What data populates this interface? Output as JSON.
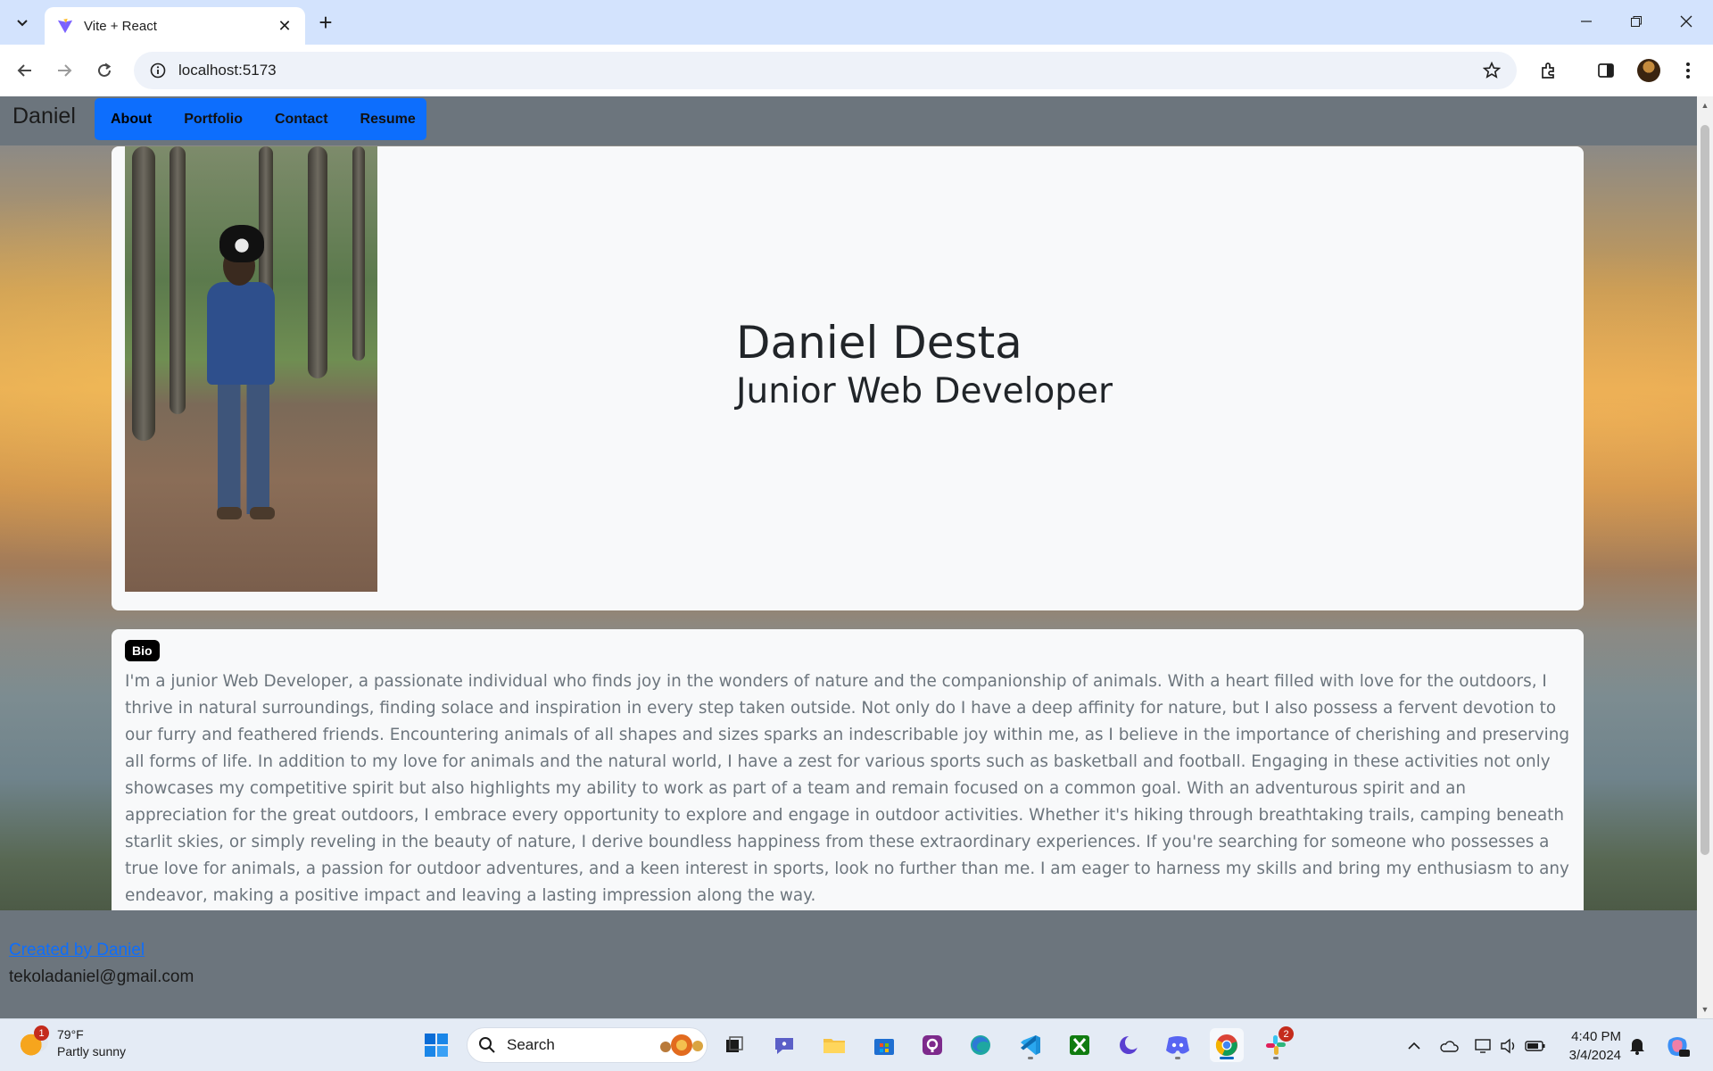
{
  "browser": {
    "tab_title": "Vite + React",
    "url": "localhost:5173"
  },
  "site": {
    "brand": "Daniel",
    "nav": [
      "About",
      "Portfolio",
      "Contact",
      "Resume"
    ],
    "hero": {
      "name": "Daniel Desta",
      "role": "Junior Web Developer"
    },
    "bio": {
      "badge": "Bio",
      "text": "I'm a junior Web Developer, a passionate individual who finds joy in the wonders of nature and the companionship of animals. With a heart filled with love for the outdoors, I thrive in natural surroundings, finding solace and inspiration in every step taken outside. Not only do I have a deep affinity for nature, but I also possess a fervent devotion to our furry and feathered friends. Encountering animals of all shapes and sizes sparks an indescribable joy within me, as I believe in the importance of cherishing and preserving all forms of life. In addition to my love for animals and the natural world, I have a zest for various sports such as basketball and football. Engaging in these activities not only showcases my competitive spirit but also highlights my ability to work as part of a team and remain focused on a common goal. With an adventurous spirit and an appreciation for the great outdoors, I embrace every opportunity to explore and engage in outdoor activities. Whether it's hiking through breathtaking trails, camping beneath starlit skies, or simply reveling in the beauty of nature, I derive boundless happiness from these extraordinary experiences. If you're searching for someone who possesses a true love for animals, a passion for outdoor adventures, and a keen interest in sports, look no further than me. I am eager to harness my skills and bring my enthusiasm to any endeavor, making a positive impact and leaving a lasting impression along the way."
    },
    "footer": {
      "credit": "Created by Daniel",
      "email": "tekoladaniel@gmail.com"
    }
  },
  "taskbar": {
    "weather_temp": "79°F",
    "weather_desc": "Partly sunny",
    "weather_badge": "1",
    "search_placeholder": "Search",
    "slack_badge": "2",
    "time": "4:40 PM",
    "date": "3/4/2024"
  },
  "colors": {
    "nav_blue": "#0d6efd",
    "navbar_gray": "#6c757d",
    "card_bg": "#f8f9fa"
  }
}
